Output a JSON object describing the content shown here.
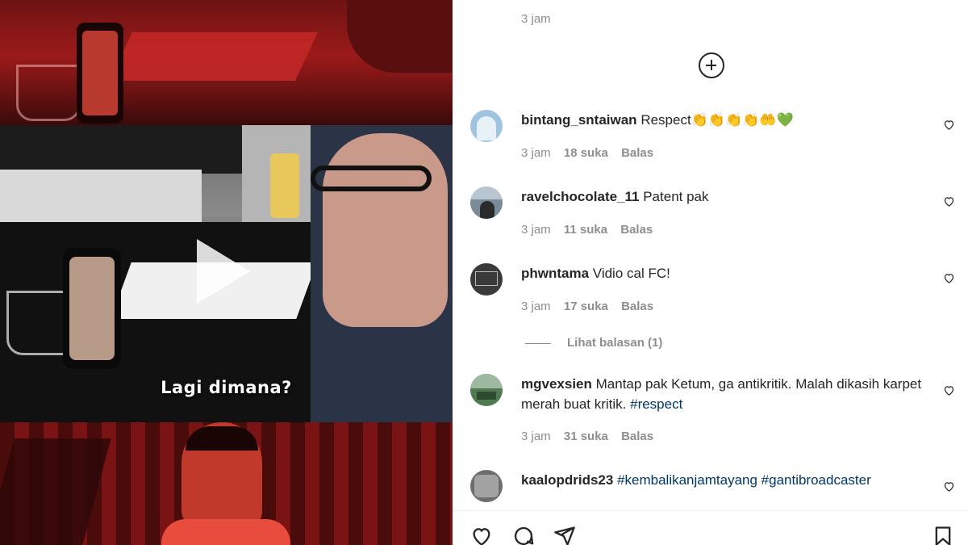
{
  "post": {
    "video_caption": "Lagi dimana?"
  },
  "comments_panel": {
    "previous_comment_time": "3 jam",
    "load_more_icon": "plus-circle-icon",
    "comments": [
      {
        "username": "bintang_sntaiwan",
        "text": "Respect👏👏👏👏🤲💚",
        "time": "3 jam",
        "likes": "18 suka",
        "reply": "Balas",
        "avatar_color": "#9fc4e0"
      },
      {
        "username": "ravelchocolate_11",
        "text": "Patent pak",
        "time": "3 jam",
        "likes": "11 suka",
        "reply": "Balas",
        "avatar_color": "#7a8b99"
      },
      {
        "username": "phwntama",
        "text": "Vidio cal FC!",
        "time": "3 jam",
        "likes": "17 suka",
        "reply": "Balas",
        "view_replies": "Lihat balasan (1)",
        "avatar_color": "#3a3a3a"
      },
      {
        "username": "mgvexsien",
        "text": "Mantap pak Ketum, ga antikritik. Malah dikasih karpet merah buat kritik. ",
        "hashtag": "#respect",
        "time": "3 jam",
        "likes": "31 suka",
        "reply": "Balas",
        "avatar_color": "#4f7a52"
      },
      {
        "username": "kaalopdrids23",
        "hashtags": "#kembalikanjamtayang #gantibroadcaster",
        "avatar_color": "#6d6d6d"
      }
    ]
  },
  "actions": {
    "like_icon": "heart-icon",
    "comment_icon": "comment-icon",
    "share_icon": "send-icon",
    "save_icon": "bookmark-icon"
  },
  "colors": {
    "text_primary": "#262626",
    "text_secondary": "#8e8e8e",
    "hashtag": "#00376b",
    "media_red": "#9c1a1a"
  }
}
